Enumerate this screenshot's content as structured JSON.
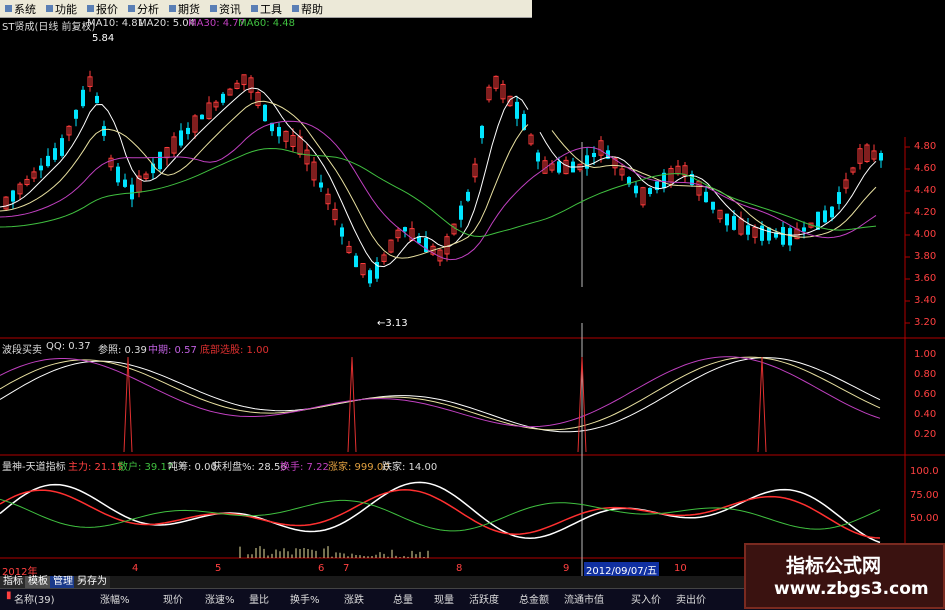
{
  "menu": [
    "系统",
    "功能",
    "报价",
    "分析",
    "期货",
    "资讯",
    "工具",
    "帮助"
  ],
  "main_panel": {
    "title": "ST贤成(日线 前复权)",
    "ma10": "MA10: 4.81",
    "ma20": "MA20: 5.04",
    "ma30": "MA30: 4.77",
    "ma60": "MA60: 4.48",
    "high_price": "5.84",
    "low_price": "←3.13",
    "y_ticks": [
      "4.80",
      "4.60",
      "4.40",
      "4.20",
      "4.00",
      "3.80",
      "3.60",
      "3.40",
      "3.20"
    ]
  },
  "mid_panel": {
    "title": "波段买卖",
    "qq": "QQ: 0.37",
    "cankao": "参照: 0.39",
    "zhongqi": "中期: 0.57",
    "dibu": "底部选股: 1.00",
    "y_ticks": [
      "1.00",
      "0.80",
      "0.60",
      "0.40",
      "0.20"
    ]
  },
  "low_panel": {
    "title": "量神-天道指标",
    "zhuli": "主力: 21.15",
    "sanhu": "散户: 39.17",
    "dunchou": "吨筹: 0.00",
    "huoli": "获利盘%: 28.56",
    "huanshou": "换手: 7.22",
    "zhangjia": "涨家: 999.00",
    "diejia": "跌家: 14.00",
    "y_ticks": [
      "100.0",
      "75.00",
      "50.00"
    ]
  },
  "timeline": {
    "year": "2012年",
    "months": [
      "4",
      "5",
      "6",
      "7",
      "8",
      "9",
      "10"
    ],
    "cursor_date": "2012/09/07/五"
  },
  "bottom_tabs": [
    "指标",
    "模板",
    "管理",
    "另存为"
  ],
  "columns": [
    "名称(39)",
    "涨幅%",
    "现价",
    "涨速%",
    "量比",
    "换手%",
    "涨跌",
    "总量",
    "现量",
    "活跃度",
    "总金额",
    "流通市值",
    "买入价",
    "卖出价"
  ],
  "watermark": {
    "line1": "指标公式网",
    "line2": "www.zbgs3.com"
  },
  "colors": {
    "up": "#ff3c3c",
    "down": "#00e5ff",
    "ma5": "#ffffff",
    "ma10": "#e8e0a0",
    "ma30": "#c040c0",
    "ma60": "#40c040",
    "axis": "#b00000"
  }
}
